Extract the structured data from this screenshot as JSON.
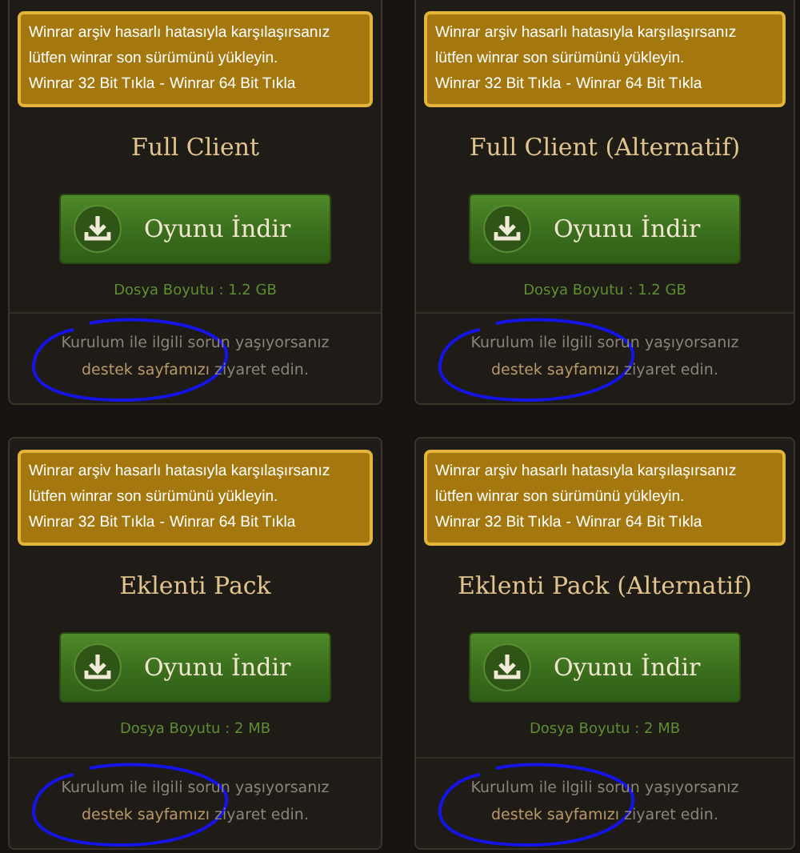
{
  "cards": [
    {
      "notice": {
        "text": "Winrar arşiv hasarlı hatasıyla karşılaşırsanız lütfen winrar son sürümünü yükleyin.",
        "links": [
          "Winrar 32 Bit Tıkla",
          "Winrar 64 Bit Tıkla"
        ],
        "separator": "-"
      },
      "title": "Full Client",
      "button": "Oyunu İndir",
      "size": "Dosya Boyutu : 1.2 GB",
      "help": {
        "before": "Kurulum ile ilgili sorun yaşıyorsanız",
        "link": "destek sayfamızı",
        "after": "ziyaret edin.",
        "circled": true
      }
    },
    {
      "notice": {
        "text": "Winrar arşiv hasarlı hatasıyla karşılaşırsanız lütfen winrar son sürümünü yükleyin.",
        "links": [
          "Winrar 32 Bit Tıkla",
          "Winrar 64 Bit Tıkla"
        ],
        "separator": "-"
      },
      "title": "Full Client (Alternatif)",
      "button": "Oyunu İndir",
      "size": "Dosya Boyutu : 1.2 GB",
      "help": {
        "before": "Kurulum ile ilgili sorun yaşıyorsanız",
        "link": "destek sayfamızı",
        "after": "ziyaret edin.",
        "circled": true
      }
    },
    {
      "notice": {
        "text": "Winrar arşiv hasarlı hatasıyla karşılaşırsanız lütfen winrar son sürümünü yükleyin.",
        "links": [
          "Winrar 32 Bit Tıkla",
          "Winrar 64 Bit Tıkla"
        ],
        "separator": "-"
      },
      "title": "Eklenti Pack",
      "button": "Oyunu İndir",
      "size": "Dosya Boyutu : 2 MB",
      "help": {
        "before": "Kurulum ile ilgili sorun yaşıyorsanız",
        "link": "destek sayfamızı",
        "after": "ziyaret edin.",
        "circled": true
      }
    },
    {
      "notice": {
        "text": "Winrar arşiv hasarlı hatasıyla karşılaşırsanız lütfen winrar son sürümünü yükleyin.",
        "links": [
          "Winrar 32 Bit Tıkla",
          "Winrar 64 Bit Tıkla"
        ],
        "separator": "-"
      },
      "title": "Eklenti Pack (Alternatif)",
      "button": "Oyunu İndir",
      "size": "Dosya Boyutu : 2 MB",
      "help": {
        "before": "Kurulum ile ilgili sorun yaşıyorsanız",
        "link": "destek sayfamızı",
        "after": "ziyaret edin.",
        "circled": true
      }
    }
  ]
}
